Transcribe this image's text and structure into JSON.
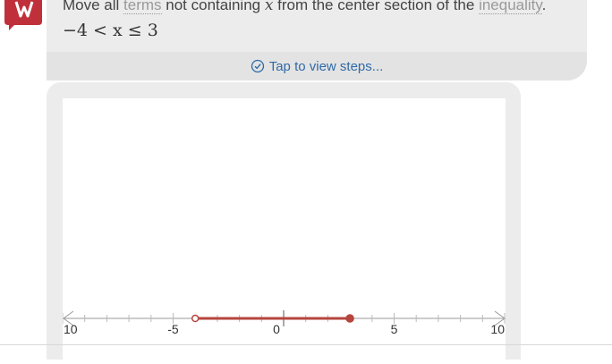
{
  "explanation": {
    "prefix": "Move all ",
    "link_terms": "terms",
    "middle": " not containing ",
    "variable": "x",
    "suffix": " from the center section of the ",
    "link_inequality": "inequality",
    "period": "."
  },
  "result": "−4 < x ≤ 3",
  "steps_button": {
    "icon": "check-circle-icon",
    "label": "Tap to view steps..."
  },
  "logo": {
    "icon": "mathway-logo-icon",
    "color": "#c0303a"
  },
  "number_line": {
    "tick_labels": [
      "10",
      "-5",
      "0",
      "5",
      "10"
    ],
    "interval": {
      "low": -4,
      "high": 3,
      "low_closed": false,
      "high_closed": true
    },
    "range": [
      -10,
      10
    ],
    "accent_color": "#b5453d"
  }
}
